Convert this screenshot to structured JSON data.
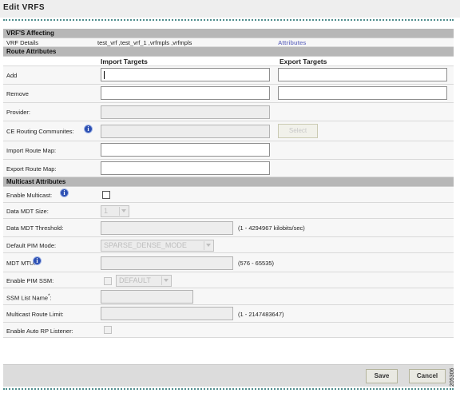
{
  "window": {
    "title": "Edit VRFS"
  },
  "sections": {
    "vrfs_affecting": {
      "header": "VRF'S Affecting",
      "vrf_details_label": "VRF Details",
      "vrf_details_value": "test_vrf ,test_vrf_1 ,vrfmpls ,vrfmpls",
      "attributes_link": "Attributes"
    },
    "route_attributes": {
      "header": "Route Attributes",
      "import_header": "Import Targets",
      "export_header": "Export Targets",
      "add_label": "Add",
      "remove_label": "Remove",
      "provider_label": "Provider:",
      "ce_routing_label": "CE Routing Communites:",
      "select_button": "Select",
      "import_route_map_label": "Import Route Map:",
      "export_route_map_label": "Export Route Map:"
    },
    "multicast_attributes": {
      "header": "Multicast Attributes",
      "enable_multicast_label": "Enable Multicast:",
      "enable_multicast_checked": false,
      "data_mdt_size_label": "Data MDT Size:",
      "data_mdt_size_value": "1",
      "data_mdt_threshold_label": "Data MDT Threshold:",
      "data_mdt_threshold_hint": "(1 - 4294967 kilobits/sec)",
      "default_pim_mode_label": "Default PIM Mode:",
      "default_pim_mode_value": "SPARSE_DENSE_MODE",
      "mdt_mtu_label": "MDT MTU:",
      "mdt_mtu_hint": "(576 - 65535)",
      "enable_pim_ssm_label": "Enable PIM SSM:",
      "pim_ssm_value": "DEFAULT",
      "ssm_list_name_label": "SSM List Name",
      "ssm_required_mark": "*",
      "ssm_list_name_colon": ":",
      "multicast_route_limit_label": "Multicast Route Limit:",
      "multicast_route_limit_hint": "(1 - 2147483647)",
      "enable_auto_rp_label": "Enable Auto RP Listener:"
    }
  },
  "footer": {
    "save_label": "Save",
    "cancel_label": "Cancel",
    "figure_id": "205306"
  },
  "icons": {
    "info": "info-icon"
  },
  "colors": {
    "section_header": "#b7b7b7",
    "link": "#7a7fc8",
    "info_icon": "#2c4fb2",
    "rule": "#4e8d8d"
  }
}
